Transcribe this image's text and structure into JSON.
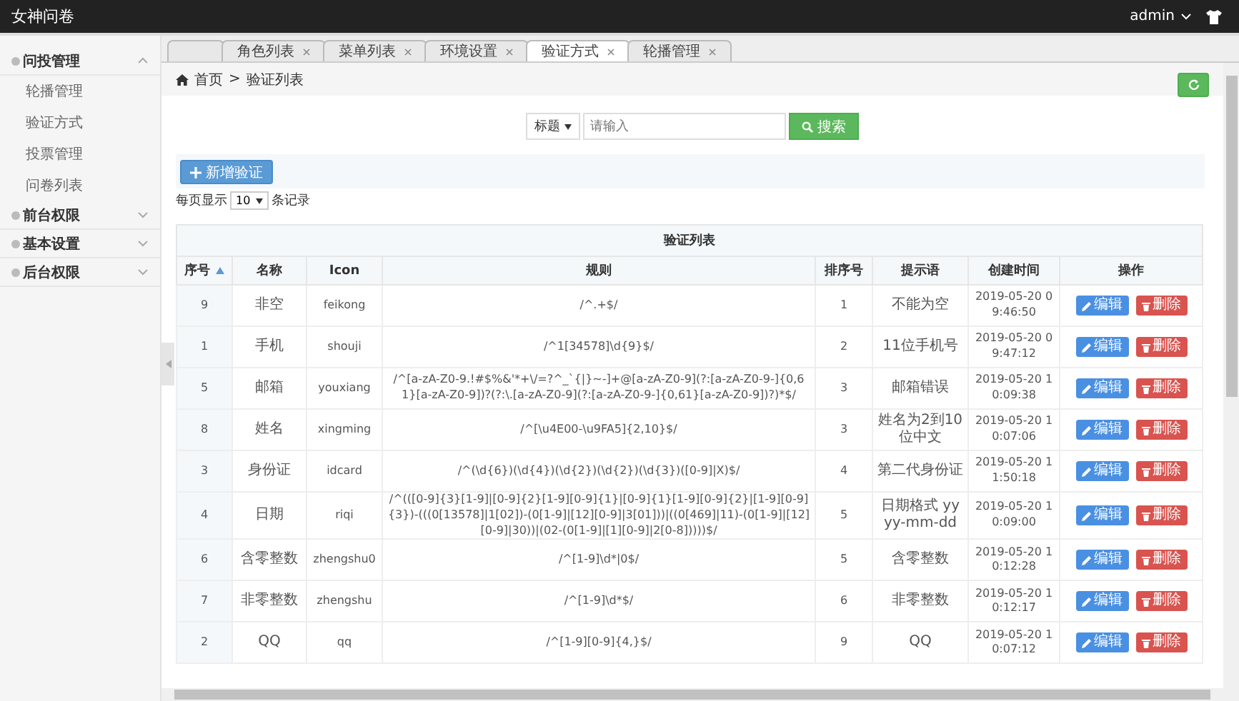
{
  "app_title": "女神问卷",
  "user": {
    "name": "admin"
  },
  "sidebar": {
    "groups": [
      {
        "label": "问投管理",
        "expanded": true,
        "children": [
          {
            "label": "轮播管理"
          },
          {
            "label": "验证方式"
          },
          {
            "label": "投票管理"
          },
          {
            "label": "问卷列表"
          }
        ]
      },
      {
        "label": "前台权限",
        "expanded": false
      },
      {
        "label": "基本设置",
        "expanded": false
      },
      {
        "label": "后台权限",
        "expanded": false
      }
    ]
  },
  "tabs": [
    {
      "label": "角色列表",
      "selected": false
    },
    {
      "label": "菜单列表",
      "selected": false
    },
    {
      "label": "环境设置",
      "selected": false
    },
    {
      "label": "验证方式",
      "selected": true
    },
    {
      "label": "轮播管理",
      "selected": false
    }
  ],
  "breadcrumb": {
    "items": [
      "首页",
      "验证列表"
    ],
    "separator": ">"
  },
  "search": {
    "field": "标题",
    "placeholder": "请输入",
    "button": "搜索"
  },
  "add_button": "新增验证",
  "page_size": {
    "prefix": "每页显示",
    "value": "10",
    "suffix": "条记录"
  },
  "table": {
    "title": "验证列表",
    "columns": [
      {
        "label": "序号",
        "sorted_ascending": true
      },
      {
        "label": "名称"
      },
      {
        "label": "Icon"
      },
      {
        "label": "规则"
      },
      {
        "label": "排序号"
      },
      {
        "label": "提示语"
      },
      {
        "label": "创建时间"
      },
      {
        "label": "操作"
      }
    ],
    "rows": [
      {
        "cells": [
          "9",
          "非空",
          "feikong",
          "/^.+$/",
          "1",
          "不能为空",
          "2019-05-20 09:46:50"
        ],
        "actions": [
          "编辑",
          "删除"
        ]
      },
      {
        "cells": [
          "1",
          "手机",
          "shouji",
          "/^1[34578]\\d{9}$/",
          "2",
          "11位手机号",
          "2019-05-20 09:47:12"
        ],
        "actions": [
          "编辑",
          "删除"
        ]
      },
      {
        "cells": [
          "5",
          "邮箱",
          "youxiang",
          "/^[a-zA-Z0-9.!#$%&'*+\\/=?^_`{|}~-]+@[a-zA-Z0-9](?:[a-zA-Z0-9-]{0,61}[a-zA-Z0-9])?(?:\\.[a-zA-Z0-9](?:[a-zA-Z0-9-]{0,61}[a-zA-Z0-9])?)*$/",
          "3",
          "邮箱错误",
          "2019-05-20 10:09:38"
        ],
        "actions": [
          "编辑",
          "删除"
        ]
      },
      {
        "cells": [
          "8",
          "姓名",
          "xingming",
          "/^[\\u4E00-\\u9FA5]{2,10}$/",
          "3",
          "姓名为2到10位中文",
          "2019-05-20 10:07:06"
        ],
        "actions": [
          "编辑",
          "删除"
        ]
      },
      {
        "cells": [
          "3",
          "身份证",
          "idcard",
          "/^(\\d{6})(\\d{4})(\\d{2})(\\d{2})(\\d{3})([0-9]|X)$/",
          "4",
          "第二代身份证",
          "2019-05-20 11:50:18"
        ],
        "actions": [
          "编辑",
          "删除"
        ]
      },
      {
        "cells": [
          "4",
          "日期",
          "riqi",
          "/^(([0-9]{3}[1-9]|[0-9]{2}[1-9][0-9]{1}|[0-9]{1}[1-9][0-9]{2}|[1-9][0-9]{3})-(((0[13578]|1[02])-(0[1-9]|[12][0-9]|3[01]))|((0[469]|11)-(0[1-9]|[12][0-9]|30))|(02-(0[1-9]|[1][0-9]|2[0-8]))))$/",
          "5",
          "日期格式 yyyy-mm-dd",
          "2019-05-20 10:09:00"
        ],
        "actions": [
          "编辑",
          "删除"
        ]
      },
      {
        "cells": [
          "6",
          "含零整数",
          "zhengshu0",
          "/^[1-9]\\d*|0$/",
          "5",
          "含零整数",
          "2019-05-20 10:12:28"
        ],
        "actions": [
          "编辑",
          "删除"
        ]
      },
      {
        "cells": [
          "7",
          "非零整数",
          "zhengshu",
          "/^[1-9]\\d*$/",
          "6",
          "非零整数",
          "2019-05-20 10:12:17"
        ],
        "actions": [
          "编辑",
          "删除"
        ]
      },
      {
        "cells": [
          "2",
          "QQ",
          "qq",
          "/^[1-9][0-9]{4,}$/",
          "9",
          "QQ",
          "2019-05-20 10:07:12"
        ],
        "actions": [
          "编辑",
          "删除"
        ]
      }
    ]
  }
}
